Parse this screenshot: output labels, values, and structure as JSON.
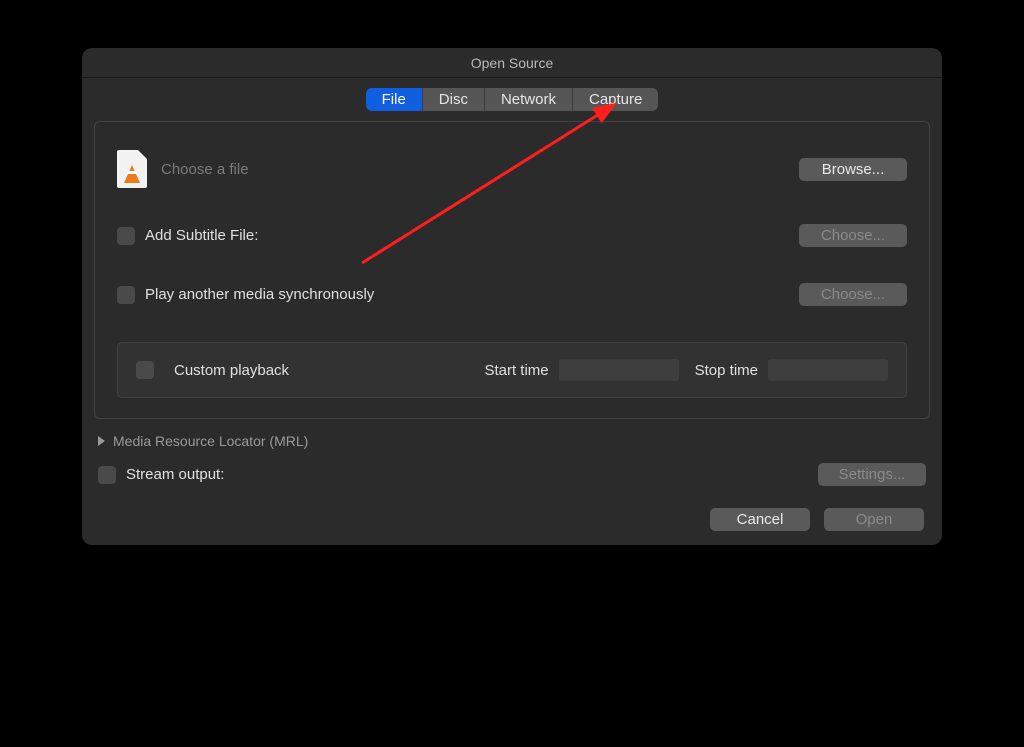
{
  "window": {
    "title": "Open Source"
  },
  "tabs": [
    {
      "label": "File",
      "active": true
    },
    {
      "label": "Disc",
      "active": false
    },
    {
      "label": "Network",
      "active": false
    },
    {
      "label": "Capture",
      "active": false
    }
  ],
  "file_section": {
    "choose_placeholder": "Choose a file",
    "browse_label": "Browse..."
  },
  "subtitle": {
    "label": "Add Subtitle File:",
    "choose_label": "Choose..."
  },
  "sync_media": {
    "label": "Play another media synchronously",
    "choose_label": "Choose..."
  },
  "custom_playback": {
    "label": "Custom playback",
    "start_label": "Start time",
    "start_value": "",
    "stop_label": "Stop time",
    "stop_value": ""
  },
  "mrl": {
    "label": "Media Resource Locator (MRL)"
  },
  "stream": {
    "label": "Stream output:",
    "settings_label": "Settings..."
  },
  "footer": {
    "cancel_label": "Cancel",
    "open_label": "Open"
  },
  "annotation": {
    "color": "#ff1e1e"
  }
}
